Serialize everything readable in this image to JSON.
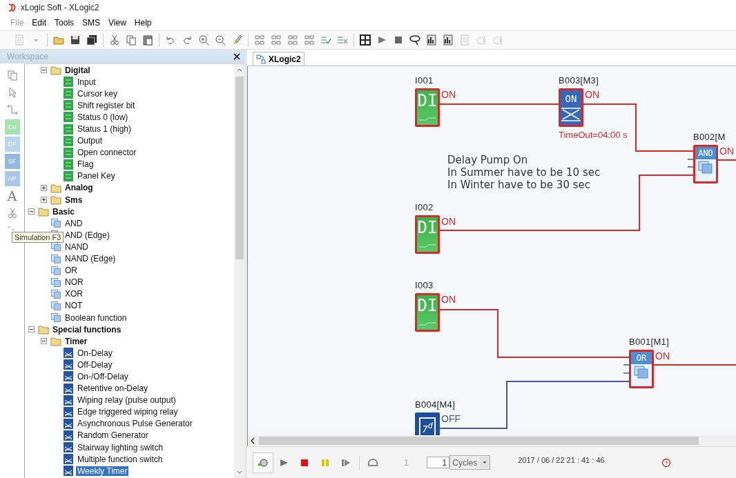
{
  "window": {
    "title": "xLogic Soft - XLogic2"
  },
  "menu": [
    {
      "label": "File",
      "disabled": true
    },
    {
      "label": "Edit",
      "disabled": false
    },
    {
      "label": "Tools",
      "disabled": false
    },
    {
      "label": "SMS",
      "disabled": false
    },
    {
      "label": "View",
      "disabled": false
    },
    {
      "label": "Help",
      "disabled": false
    }
  ],
  "workspace": {
    "title": "Workspace",
    "tooltip": "Simulation F3",
    "tools": [
      {
        "kind": "layers"
      },
      {
        "kind": "pointer"
      },
      {
        "kind": "wire"
      },
      {
        "kind": "tag",
        "label": "Co",
        "color": "#a8e2b2"
      },
      {
        "kind": "tag",
        "label": "GF",
        "color": "#b9d5f0"
      },
      {
        "kind": "tag",
        "label": "SF",
        "color": "#92b9e4"
      },
      {
        "kind": "tag",
        "label": "AP",
        "color": "#a9c7ea"
      },
      {
        "kind": "glyph",
        "label": "A"
      },
      {
        "kind": "scissors"
      },
      {
        "kind": "simulation"
      }
    ],
    "tree": [
      {
        "children": [
          {
            "label": "Digital",
            "kind": "folder",
            "expanded": true,
            "selected": false,
            "children": [
              {
                "label": "Input",
                "kind": "digital",
                "selected": false
              },
              {
                "label": "Cursor key",
                "kind": "digital",
                "selected": false
              },
              {
                "label": "Shift register bit",
                "kind": "digital",
                "selected": false
              },
              {
                "label": "Status 0 (low)",
                "kind": "digital",
                "selected": false
              },
              {
                "label": "Status 1 (high)",
                "kind": "digital",
                "selected": false
              },
              {
                "label": "Output",
                "kind": "digital",
                "selected": false
              },
              {
                "label": "Open connector",
                "kind": "digital",
                "selected": false
              },
              {
                "label": "Flag",
                "kind": "digital",
                "selected": false
              },
              {
                "label": "Panel Key",
                "kind": "digital",
                "selected": false
              }
            ]
          },
          {
            "label": "Analog",
            "kind": "folder",
            "expanded": false,
            "selected": false
          },
          {
            "label": "Sms",
            "kind": "folder",
            "expanded": false,
            "selected": false
          }
        ]
      },
      {
        "label": "Basic",
        "kind": "folder",
        "expanded": true,
        "selected": false,
        "children": [
          {
            "label": "AND",
            "kind": "basic",
            "selected": false
          },
          {
            "label": "AND (Edge)",
            "kind": "basic",
            "selected": false
          },
          {
            "label": "NAND",
            "kind": "basic",
            "selected": false
          },
          {
            "label": "NAND (Edge)",
            "kind": "basic",
            "selected": false
          },
          {
            "label": "OR",
            "kind": "basic",
            "selected": false
          },
          {
            "label": "NOR",
            "kind": "basic",
            "selected": false
          },
          {
            "label": "XOR",
            "kind": "basic",
            "selected": false
          },
          {
            "label": "NOT",
            "kind": "basic",
            "selected": false
          },
          {
            "label": "Boolean function",
            "kind": "basic",
            "selected": false
          }
        ]
      },
      {
        "label": "Special functions",
        "kind": "folder",
        "expanded": true,
        "selected": false,
        "children": [
          {
            "label": "Timer",
            "kind": "folder",
            "expanded": true,
            "selected": false,
            "children": [
              {
                "label": "On-Delay",
                "kind": "timer",
                "selected": false
              },
              {
                "label": "Off-Delay",
                "kind": "timer",
                "selected": false
              },
              {
                "label": "On-/Off-Delay",
                "kind": "timer",
                "selected": false
              },
              {
                "label": "Retentive on-Delay",
                "kind": "timer",
                "selected": false
              },
              {
                "label": "Wiping relay (pulse output)",
                "kind": "timer",
                "selected": false
              },
              {
                "label": "Edge triggered wiping relay",
                "kind": "timer",
                "selected": false
              },
              {
                "label": "Asynchronous Pulse Generator",
                "kind": "timer",
                "selected": false
              },
              {
                "label": "Random Generator",
                "kind": "timer",
                "selected": false
              },
              {
                "label": "Stairway lighting switch",
                "kind": "timer",
                "selected": false
              },
              {
                "label": "Multiple function switch",
                "kind": "timer",
                "selected": false
              },
              {
                "label": "Weekly Timer",
                "kind": "timer",
                "selected": true
              }
            ]
          }
        ]
      }
    ]
  },
  "editor": {
    "tabs": [
      {
        "label": "XLogic2",
        "selected": true
      }
    ],
    "blocks": [
      {
        "kind": "di",
        "name": "I001",
        "symbol": "DI",
        "output": "ON",
        "active": true
      },
      {
        "kind": "timer",
        "name": "B003[M3]",
        "symbol": "ON",
        "output": "ON",
        "active": true,
        "parameter": "TimeOut=04:00 s"
      },
      {
        "kind": "and",
        "name": "B002[M",
        "symbol": "AND",
        "output": "ON",
        "active": true
      },
      {
        "kind": "di",
        "name": "I002",
        "symbol": "DI",
        "output": "ON",
        "active": true
      },
      {
        "kind": "di",
        "name": "I003",
        "symbol": "DI",
        "output": "ON",
        "active": true
      },
      {
        "kind": "or",
        "name": "B001[M1]",
        "symbol": "OR",
        "output": "ON",
        "active": true
      },
      {
        "kind": "weekly",
        "name": "B004[M4]",
        "symbol": "7$^{d}$",
        "output": "OFF",
        "active": false
      }
    ],
    "comment": "Delay Pump On\nIn Summer have to be 10 sec\nIn Winter have to be 30 sec",
    "wires": [
      {
        "on": true
      },
      {
        "on": true
      },
      {
        "on": true
      },
      {
        "on": true
      },
      {
        "on": true
      },
      {
        "on": true
      },
      {
        "on": false
      }
    ]
  },
  "simulation": {
    "step": "1",
    "cycles": "1",
    "unit": "Cycles",
    "clock": "2017 / 06 / 22 21 : 41 : 46"
  }
}
